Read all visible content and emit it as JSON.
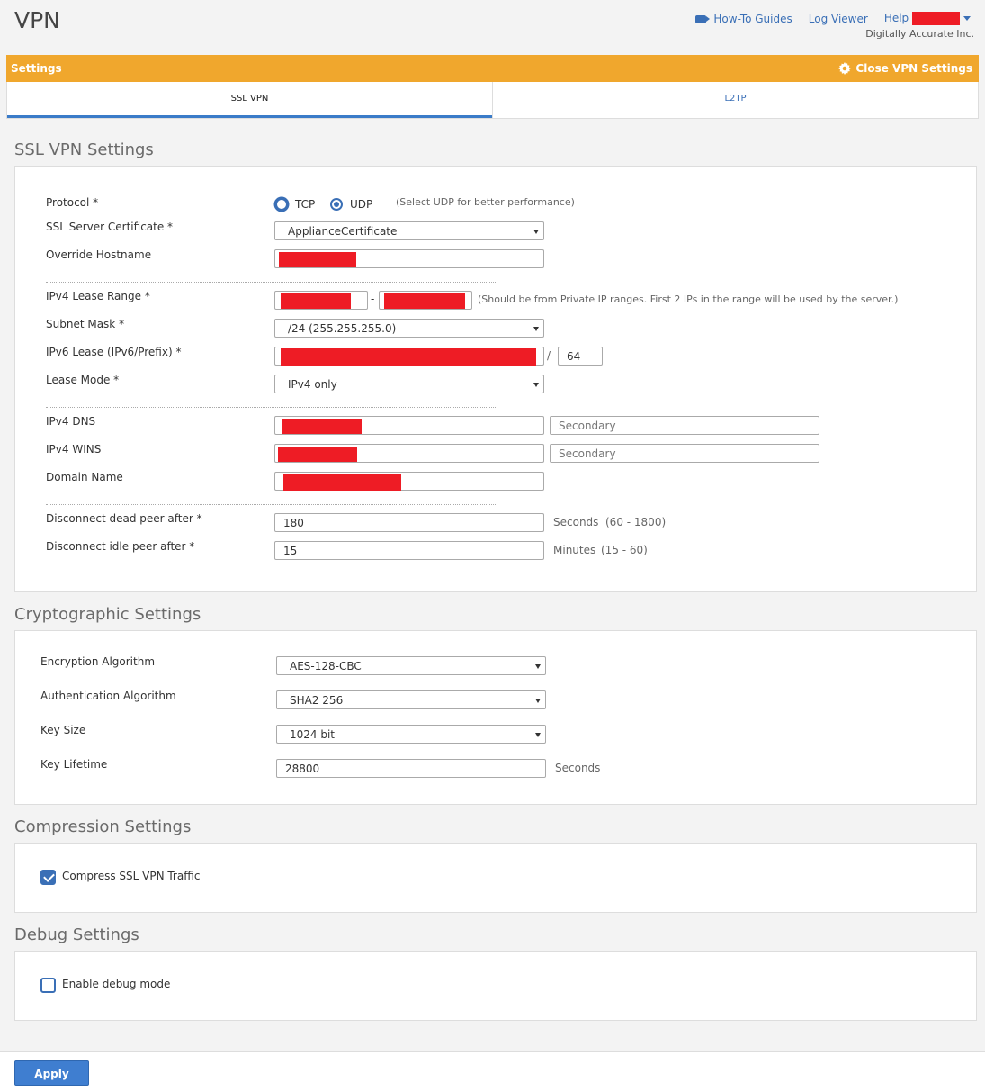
{
  "header": {
    "title": "VPN",
    "links": {
      "howto": "How-To Guides",
      "logviewer": "Log Viewer",
      "help": "Help"
    },
    "org": "Digitally Accurate Inc.",
    "icons": {
      "howto": "video-camera-icon",
      "user_menu": "chevron-down-icon"
    }
  },
  "settings_bar": {
    "label": "Settings",
    "close_label": "Close VPN Settings",
    "color": "#f0a72d",
    "close_icon": "gear-icon"
  },
  "tabs": [
    {
      "label": "SSL VPN",
      "active": true
    },
    {
      "label": "L2TP",
      "active": false
    }
  ],
  "ssl_vpn": {
    "title": "SSL VPN Settings",
    "protocol": {
      "label": "Protocol *",
      "options": [
        "TCP",
        "UDP"
      ],
      "selected": "UDP",
      "hint": "(Select UDP for better performance)"
    },
    "certificate": {
      "label": "SSL Server Certificate *",
      "value": "ApplianceCertificate"
    },
    "override_hostname": {
      "label": "Override Hostname"
    },
    "ipv4_lease": {
      "label": "IPv4 Lease Range *",
      "separator": "-",
      "hint": "(Should be from Private IP ranges. First 2 IPs in the range will be used by the server.)"
    },
    "subnet": {
      "label": "Subnet Mask *",
      "value": "/24 (255.255.255.0)"
    },
    "ipv6_lease": {
      "label": "IPv6 Lease (IPv6/Prefix) *",
      "separator": "/",
      "prefix": "64"
    },
    "lease_mode": {
      "label": "Lease Mode *",
      "value": "IPv4 only"
    },
    "dns": {
      "label": "IPv4 DNS",
      "secondary_placeholder": "Secondary"
    },
    "wins": {
      "label": "IPv4 WINS",
      "secondary_placeholder": "Secondary"
    },
    "domain": {
      "label": "Domain Name"
    },
    "dead_peer": {
      "label": "Disconnect dead peer after *",
      "value": "180",
      "unit": "Seconds",
      "range": "(60 - 1800)"
    },
    "idle_peer": {
      "label": "Disconnect idle peer after *",
      "value": "15",
      "unit": "Minutes",
      "range": "(15 - 60)"
    }
  },
  "crypto": {
    "title": "Cryptographic Settings",
    "encryption": {
      "label": "Encryption Algorithm",
      "value": "AES-128-CBC"
    },
    "authentication": {
      "label": "Authentication Algorithm",
      "value": "SHA2 256"
    },
    "key_size": {
      "label": "Key Size",
      "value": "1024 bit"
    },
    "key_lifetime": {
      "label": "Key Lifetime",
      "value": "28800",
      "unit": "Seconds"
    }
  },
  "compression": {
    "title": "Compression Settings",
    "label": "Compress SSL VPN Traffic",
    "checked": true
  },
  "debug": {
    "title": "Debug Settings",
    "label": "Enable debug mode",
    "checked": false
  },
  "footer": {
    "apply_label": "Apply",
    "accent": "#3f7ed0"
  }
}
